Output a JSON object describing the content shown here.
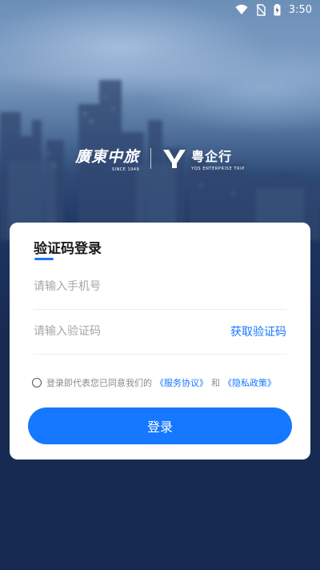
{
  "status_bar": {
    "time": "3:50",
    "icons": [
      "wifi-icon",
      "no-sim-icon",
      "battery-charging-icon"
    ]
  },
  "brand": {
    "left_name": "廣東中旅",
    "left_since": "SINCE 1949",
    "right_name": "粤企行",
    "right_tagline": "YQS ENTERPRISE TRIP"
  },
  "login": {
    "title": "验证码登录",
    "phone_placeholder": "请输入手机号",
    "code_placeholder": "请输入验证码",
    "get_code_label": "获取验证码",
    "agreement_prefix": "登录即代表您已同意我们的",
    "service_agreement": "《服务协议》",
    "agreement_and": "和",
    "privacy_policy": "《隐私政策》",
    "login_button": "登录"
  },
  "colors": {
    "accent": "#1677ff",
    "background": "#172a52",
    "card": "#ffffff"
  }
}
